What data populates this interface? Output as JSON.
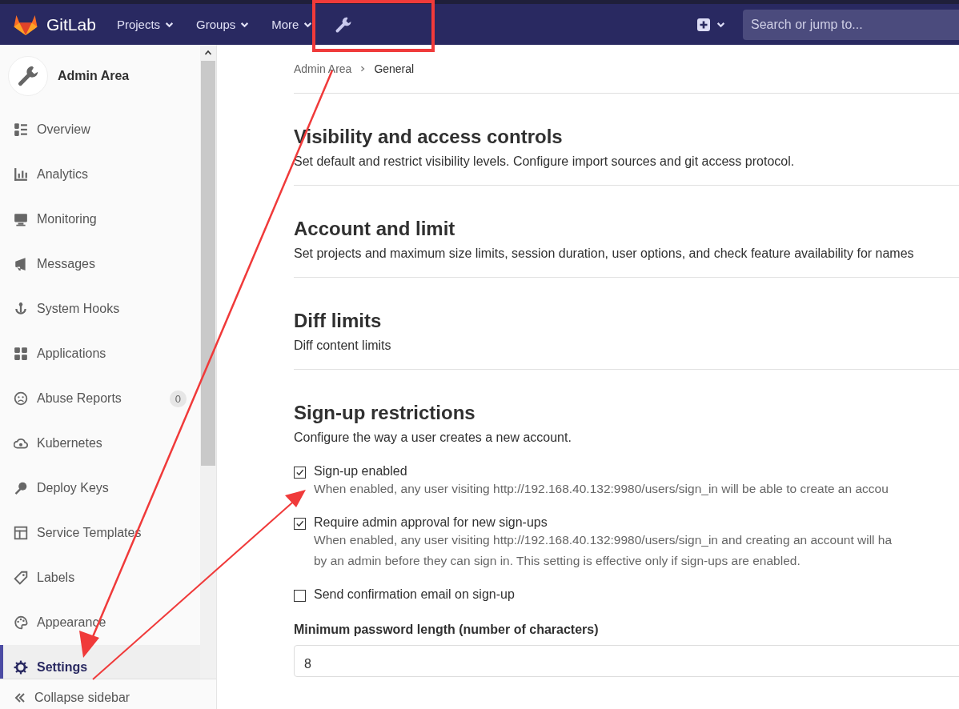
{
  "topbar": {
    "brand": "GitLab",
    "nav": [
      {
        "label": "Projects",
        "kind": "dropdown"
      },
      {
        "label": "Groups",
        "kind": "dropdown"
      },
      {
        "label": "More",
        "kind": "dropdown"
      },
      {
        "kind": "admin"
      }
    ],
    "search": {
      "placeholder": "Search or jump to..."
    }
  },
  "sidebar": {
    "title": "Admin Area",
    "items": [
      {
        "label": "Overview",
        "selected": false
      },
      {
        "label": "Analytics",
        "selected": false
      },
      {
        "label": "Monitoring",
        "selected": false
      },
      {
        "label": "Messages",
        "selected": false
      },
      {
        "label": "System Hooks",
        "selected": false
      },
      {
        "label": "Applications",
        "selected": false
      },
      {
        "label": "Abuse Reports",
        "selected": false,
        "badge": "0"
      },
      {
        "label": "Kubernetes",
        "selected": false
      },
      {
        "label": "Deploy Keys",
        "selected": false
      },
      {
        "label": "Service Templates",
        "selected": false
      },
      {
        "label": "Labels",
        "selected": false
      },
      {
        "label": "Appearance",
        "selected": false
      },
      {
        "label": "Settings",
        "selected": true
      }
    ],
    "collapse": "Collapse sidebar"
  },
  "breadcrumb": [
    "Admin Area",
    "General"
  ],
  "sections": [
    {
      "title": "Visibility and access controls",
      "description": "Set default and restrict visibility levels. Configure import sources and git access protocol."
    },
    {
      "title": "Account and limit",
      "description": "Set projects and maximum size limits, session duration, user options, and check feature availability for names"
    },
    {
      "title": "Diff limits",
      "description": "Diff content limits"
    },
    {
      "title": "Sign-up restrictions",
      "description": "Configure the way a user creates a new account."
    }
  ],
  "signup_options": [
    {
      "label": "Sign-up enabled",
      "checked": true,
      "help": [
        "When enabled, any user visiting http://192.168.40.132:9980/users/sign_in will be able to create an accou"
      ]
    },
    {
      "label": "Require admin approval for new sign-ups",
      "checked": true,
      "help": [
        "When enabled, any user visiting http://192.168.40.132:9980/users/sign_in and creating an account will ha",
        "by an admin before they can sign in. This setting is effective only if sign-ups are enabled."
      ]
    },
    {
      "label": "Send confirmation email on sign-up",
      "checked": false
    }
  ],
  "password_field": {
    "label": "Minimum password length (number of characters)",
    "value": "8"
  },
  "annotations": [
    {
      "kind": "highlight-box"
    },
    {
      "kind": "arrow"
    },
    {
      "kind": "arrow"
    }
  ]
}
